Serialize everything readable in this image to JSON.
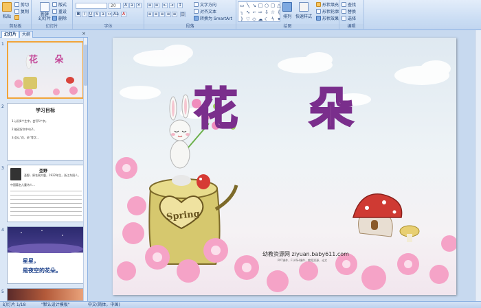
{
  "ribbon": {
    "clipboard": {
      "label": "剪贴板",
      "paste": "粘贴",
      "cut": "剪切",
      "copy": "复制",
      "format_painter": "格式刷"
    },
    "slides": {
      "label": "幻灯片",
      "new_slide": "新建\n幻灯片",
      "layout": "版式",
      "reset": "重设",
      "delete": "删除"
    },
    "font": {
      "label": "字体",
      "size": "20"
    },
    "paragraph": {
      "label": "段落",
      "text_direction": "文字方向",
      "align_text": "对齐文本",
      "smartart": "转换为 SmartArt"
    },
    "drawing": {
      "label": "绘图",
      "arrange": "排列",
      "quick_styles": "快速样式",
      "shape_fill": "形状填充",
      "shape_outline": "形状轮廓",
      "shape_effects": "形状效果"
    },
    "editing": {
      "label": "编辑",
      "find": "查找",
      "replace": "替换",
      "select": "选择"
    }
  },
  "panel": {
    "tab_slides": "幻灯片",
    "tab_outline": "大纲",
    "close": "×",
    "thumbs": [
      {
        "num": "1",
        "title": "花  朵"
      },
      {
        "num": "2",
        "title": "学习目标",
        "lines": [
          "1.认识8个生字，会写5个字。",
          "2.能读好文中句子。",
          "3.会认“花、朵”等字…"
        ]
      },
      {
        "num": "3",
        "title": "圣野",
        "lines": [
          "圣野，原名周大鹿，1922年生，浙江东阳人。",
          "中国著名儿童诗人…"
        ]
      },
      {
        "num": "4",
        "title": "星星，",
        "subtitle": "是夜空的花朵。"
      },
      {
        "num": "5"
      }
    ]
  },
  "slide": {
    "char1": "花",
    "char2": "朵",
    "sign": "Spring",
    "watermark": "幼教资源网 ziyuan.baby611.com",
    "watermark_sub": "PPT课件、FLASH课件、教案资源、论文"
  },
  "status": {
    "slide_info": "幻灯片 1/18",
    "theme": "\"默认设计模板\"",
    "language": "中文(简体，中国)"
  },
  "colors": {
    "accent": "#f1a43a",
    "ribbon": "#c9dcf3",
    "title_purple": "#7a2e8c"
  }
}
